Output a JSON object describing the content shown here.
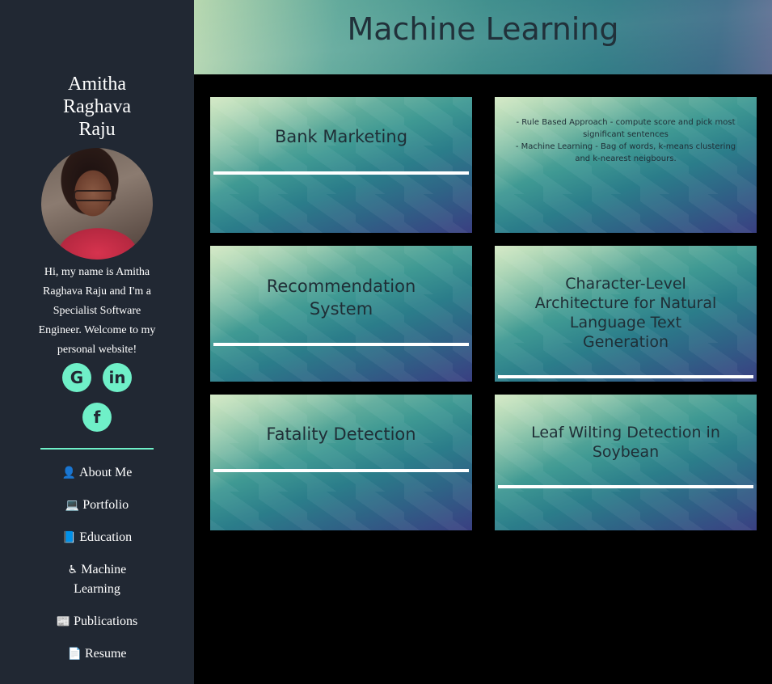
{
  "sidebar": {
    "name": "Amitha Raghava Raju",
    "bio": "Hi, my name is Amitha Raghava Raju and I'm a Specialist Software Engineer. Welcome to my personal website!",
    "social": [
      {
        "icon": "github-icon",
        "glyph": "G"
      },
      {
        "icon": "linkedin-icon",
        "glyph": "in"
      },
      {
        "icon": "facebook-icon",
        "glyph": "f"
      }
    ],
    "nav": [
      {
        "icon": "user-icon",
        "glyph": "👤",
        "label": "About Me"
      },
      {
        "icon": "laptop-icon",
        "glyph": "💻",
        "label": "Portfolio"
      },
      {
        "icon": "book-icon",
        "glyph": "📘",
        "label": "Education"
      },
      {
        "icon": "accessibility-icon",
        "glyph": "♿",
        "label": "Machine Learning"
      },
      {
        "icon": "newspaper-icon",
        "glyph": "📰",
        "label": "Publications"
      },
      {
        "icon": "file-icon",
        "glyph": "📄",
        "label": "Resume"
      }
    ]
  },
  "header": {
    "title": "Machine Learning"
  },
  "cards": [
    {
      "title": "Bank Marketing"
    },
    {
      "desc_lines": [
        "- Rule Based Approach - compute score and pick most significant sentences",
        "- Machine Learning - Bag of words, k-means clustering and k-nearest neigbours."
      ]
    },
    {
      "title": "Recommendation System"
    },
    {
      "title": "Character-Level Architecture for Natural Language Text Generation"
    },
    {
      "title": "Fatality Detection"
    },
    {
      "title": "Leaf Wilting Detection in Soybean"
    }
  ]
}
